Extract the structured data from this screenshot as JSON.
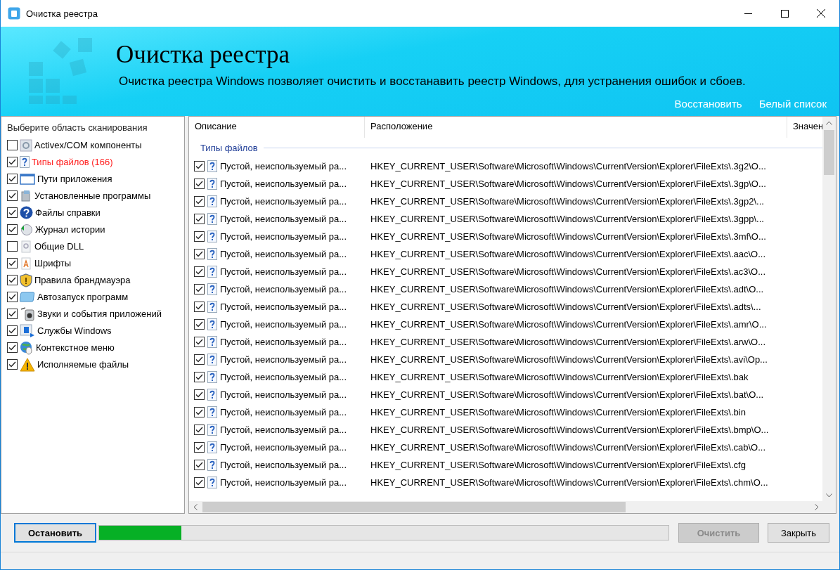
{
  "window": {
    "title": "Очистка реестра"
  },
  "banner": {
    "title": "Очистка реестра",
    "subtitle": "Очистка реестра Windows позволяет очистить и восстанавить реестр Windows, для устранения ошибок и сбоев.",
    "links": [
      "Восстановить",
      "Белый список"
    ]
  },
  "scan_areas": {
    "heading": "Выберите область сканирования",
    "items": [
      {
        "label": "Activex/COM компоненты",
        "checked": false,
        "has_results": false
      },
      {
        "label": "Типы файлов (166)",
        "checked": true,
        "has_results": true
      },
      {
        "label": "Пути приложения",
        "checked": true,
        "has_results": false
      },
      {
        "label": "Установленные программы",
        "checked": true,
        "has_results": false
      },
      {
        "label": "Файлы справки",
        "checked": true,
        "has_results": false
      },
      {
        "label": "Журнал истории",
        "checked": true,
        "has_results": false
      },
      {
        "label": "Общие DLL",
        "checked": false,
        "has_results": false
      },
      {
        "label": "Шрифты",
        "checked": true,
        "has_results": false
      },
      {
        "label": "Правила брандмауэра",
        "checked": true,
        "has_results": false
      },
      {
        "label": "Автозапуск программ",
        "checked": true,
        "has_results": false
      },
      {
        "label": "Звуки и события приложений",
        "checked": true,
        "has_results": false
      },
      {
        "label": "Службы Windows",
        "checked": true,
        "has_results": false
      },
      {
        "label": "Контекстное меню",
        "checked": true,
        "has_results": false
      },
      {
        "label": "Исполняемые файлы",
        "checked": true,
        "has_results": false
      }
    ]
  },
  "table": {
    "columns": [
      "Описание",
      "Расположение",
      "Значен"
    ],
    "group": "Типы файлов",
    "rows": [
      {
        "checked": true,
        "description": "Пустой, неиспользуемый ра...",
        "location": "HKEY_CURRENT_USER\\Software\\Microsoft\\Windows\\CurrentVersion\\Explorer\\FileExts\\.3g2\\O..."
      },
      {
        "checked": true,
        "description": "Пустой, неиспользуемый ра...",
        "location": "HKEY_CURRENT_USER\\Software\\Microsoft\\Windows\\CurrentVersion\\Explorer\\FileExts\\.3gp\\O..."
      },
      {
        "checked": true,
        "description": "Пустой, неиспользуемый ра...",
        "location": "HKEY_CURRENT_USER\\Software\\Microsoft\\Windows\\CurrentVersion\\Explorer\\FileExts\\.3gp2\\..."
      },
      {
        "checked": true,
        "description": "Пустой, неиспользуемый ра...",
        "location": "HKEY_CURRENT_USER\\Software\\Microsoft\\Windows\\CurrentVersion\\Explorer\\FileExts\\.3gpp\\..."
      },
      {
        "checked": true,
        "description": "Пустой, неиспользуемый ра...",
        "location": "HKEY_CURRENT_USER\\Software\\Microsoft\\Windows\\CurrentVersion\\Explorer\\FileExts\\.3mf\\O..."
      },
      {
        "checked": true,
        "description": "Пустой, неиспользуемый ра...",
        "location": "HKEY_CURRENT_USER\\Software\\Microsoft\\Windows\\CurrentVersion\\Explorer\\FileExts\\.aac\\O..."
      },
      {
        "checked": true,
        "description": "Пустой, неиспользуемый ра...",
        "location": "HKEY_CURRENT_USER\\Software\\Microsoft\\Windows\\CurrentVersion\\Explorer\\FileExts\\.ac3\\O..."
      },
      {
        "checked": true,
        "description": "Пустой, неиспользуемый ра...",
        "location": "HKEY_CURRENT_USER\\Software\\Microsoft\\Windows\\CurrentVersion\\Explorer\\FileExts\\.adt\\O..."
      },
      {
        "checked": true,
        "description": "Пустой, неиспользуемый ра...",
        "location": "HKEY_CURRENT_USER\\Software\\Microsoft\\Windows\\CurrentVersion\\Explorer\\FileExts\\.adts\\..."
      },
      {
        "checked": true,
        "description": "Пустой, неиспользуемый ра...",
        "location": "HKEY_CURRENT_USER\\Software\\Microsoft\\Windows\\CurrentVersion\\Explorer\\FileExts\\.amr\\O..."
      },
      {
        "checked": true,
        "description": "Пустой, неиспользуемый ра...",
        "location": "HKEY_CURRENT_USER\\Software\\Microsoft\\Windows\\CurrentVersion\\Explorer\\FileExts\\.arw\\O..."
      },
      {
        "checked": true,
        "description": "Пустой, неиспользуемый ра...",
        "location": "HKEY_CURRENT_USER\\Software\\Microsoft\\Windows\\CurrentVersion\\Explorer\\FileExts\\.avi\\Op..."
      },
      {
        "checked": true,
        "description": "Пустой, неиспользуемый ра...",
        "location": "HKEY_CURRENT_USER\\Software\\Microsoft\\Windows\\CurrentVersion\\Explorer\\FileExts\\.bak"
      },
      {
        "checked": true,
        "description": "Пустой, неиспользуемый ра...",
        "location": "HKEY_CURRENT_USER\\Software\\Microsoft\\Windows\\CurrentVersion\\Explorer\\FileExts\\.bat\\O..."
      },
      {
        "checked": true,
        "description": "Пустой, неиспользуемый ра...",
        "location": "HKEY_CURRENT_USER\\Software\\Microsoft\\Windows\\CurrentVersion\\Explorer\\FileExts\\.bin"
      },
      {
        "checked": true,
        "description": "Пустой, неиспользуемый ра...",
        "location": "HKEY_CURRENT_USER\\Software\\Microsoft\\Windows\\CurrentVersion\\Explorer\\FileExts\\.bmp\\O..."
      },
      {
        "checked": true,
        "description": "Пустой, неиспользуемый ра...",
        "location": "HKEY_CURRENT_USER\\Software\\Microsoft\\Windows\\CurrentVersion\\Explorer\\FileExts\\.cab\\O..."
      },
      {
        "checked": true,
        "description": "Пустой, неиспользуемый ра...",
        "location": "HKEY_CURRENT_USER\\Software\\Microsoft\\Windows\\CurrentVersion\\Explorer\\FileExts\\.cfg"
      },
      {
        "checked": true,
        "description": "Пустой, неиспользуемый ра...",
        "location": "HKEY_CURRENT_USER\\Software\\Microsoft\\Windows\\CurrentVersion\\Explorer\\FileExts\\.chm\\O..."
      }
    ]
  },
  "footer": {
    "stop_button": "Остановить",
    "progress": {
      "level": 0.145
    },
    "clean_button": {
      "label": "Очистить",
      "disabled": true
    },
    "close_button": "Закрыть"
  }
}
